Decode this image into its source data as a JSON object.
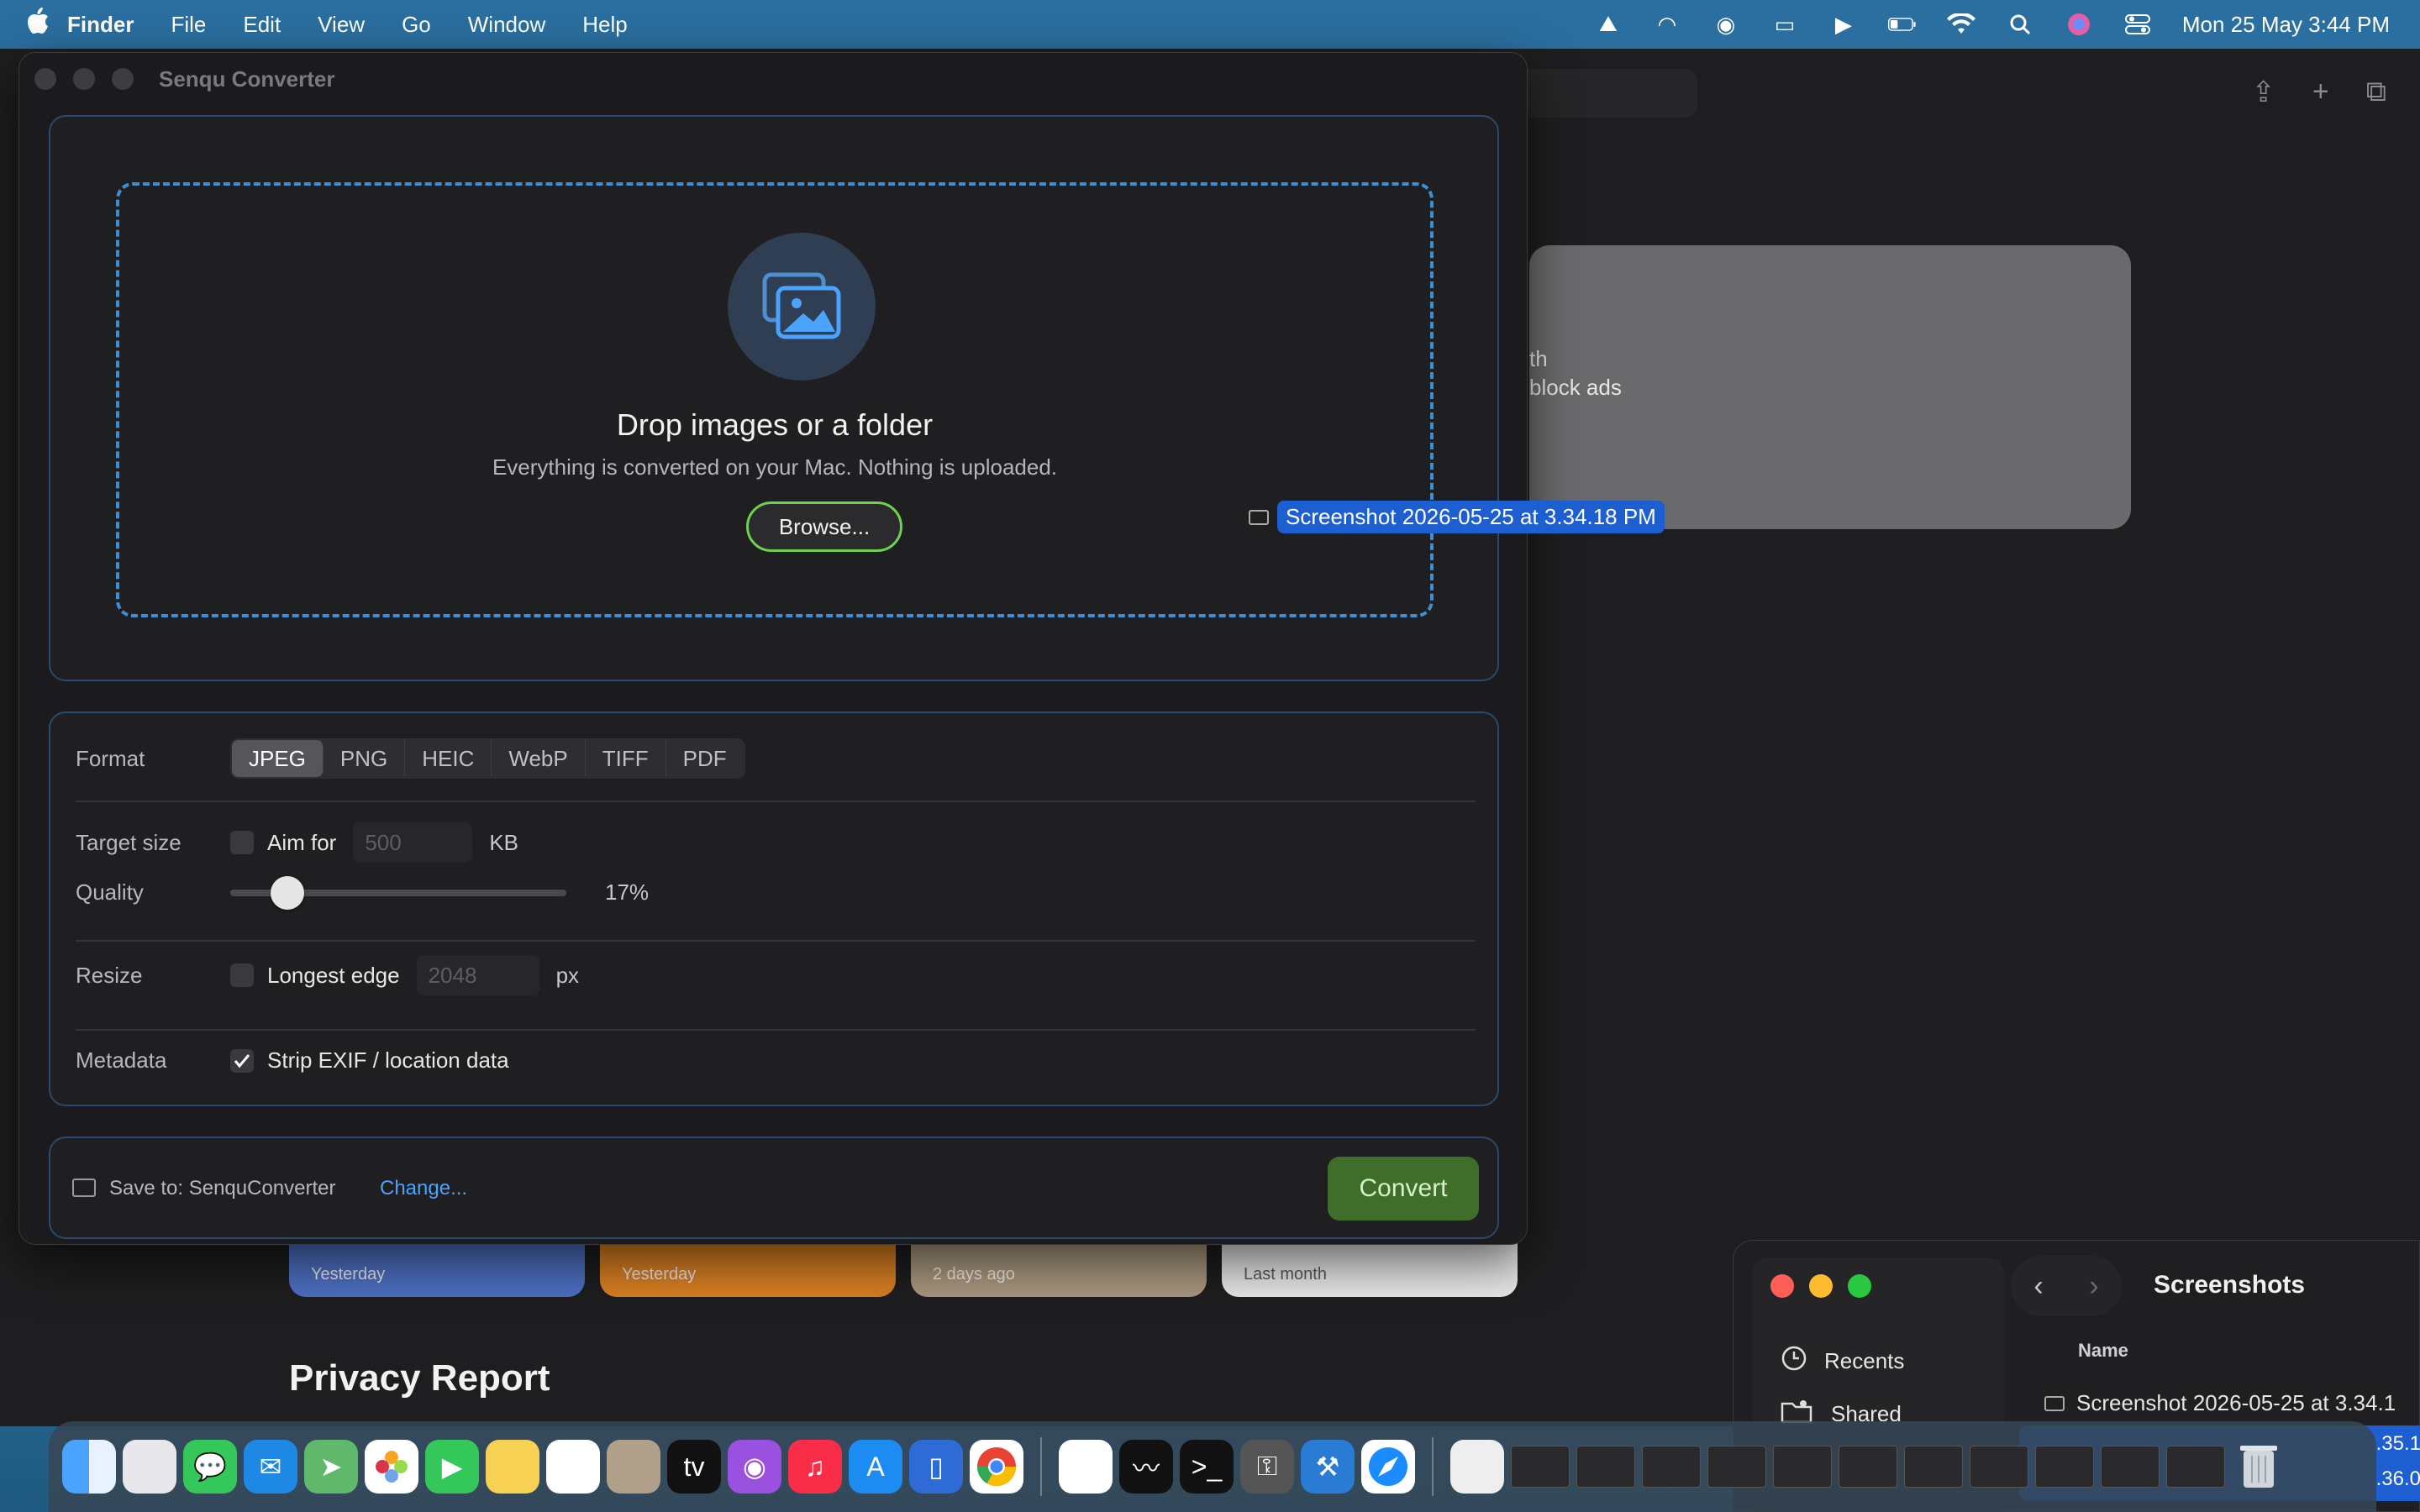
{
  "menubar": {
    "apple": "",
    "app_name": "Finder",
    "items": [
      "File",
      "Edit",
      "View",
      "Go",
      "Window",
      "Help"
    ],
    "clock": "Mon 25 May  3:44 PM"
  },
  "background": {
    "card_line1": "th",
    "card_line2": "block ads",
    "tiles": [
      "Yesterday",
      "Yesterday",
      "2 days ago",
      "Last month"
    ],
    "privacy_title": "Privacy Report"
  },
  "drag_ghost": {
    "label": "Screenshot 2026-05-25 at 3.34.18 PM"
  },
  "converter": {
    "title": "Senqu Converter",
    "drop_heading": "Drop images or a folder",
    "drop_sub": "Everything is converted on your Mac. Nothing is uploaded.",
    "browse_label": "Browse...",
    "format_label": "Format",
    "formats": [
      "JPEG",
      "PNG",
      "HEIC",
      "WebP",
      "TIFF",
      "PDF"
    ],
    "selected_format": "JPEG",
    "target_size_label": "Target size",
    "aim_for_label": "Aim for",
    "aim_for_placeholder": "500",
    "aim_for_unit": "KB",
    "aim_for_checked": false,
    "quality_label": "Quality",
    "quality_value": 17,
    "quality_text": "17%",
    "resize_label": "Resize",
    "longest_edge_label": "Longest edge",
    "longest_edge_placeholder": "2048",
    "longest_edge_unit": "px",
    "longest_edge_checked": false,
    "metadata_label": "Metadata",
    "strip_exif_label": "Strip EXIF / location data",
    "strip_exif_checked": true,
    "save_to": "Save to: SenquConverter",
    "change_label": "Change...",
    "convert_label": "Convert"
  },
  "finder": {
    "title": "Screenshots",
    "sidebar": [
      "Recents",
      "Shared"
    ],
    "column_name": "Name",
    "row": "Screenshot 2026-05-25 at 3.34.1",
    "sel_line1": ".35.1",
    "sel_line2": ".36.0"
  },
  "colors": {
    "accent_blue": "#3a8fd6",
    "browse_border": "#6dd24e",
    "convert_bg": "#3f6e2a",
    "link": "#4aa3ff",
    "selection": "#1d5fd1"
  }
}
